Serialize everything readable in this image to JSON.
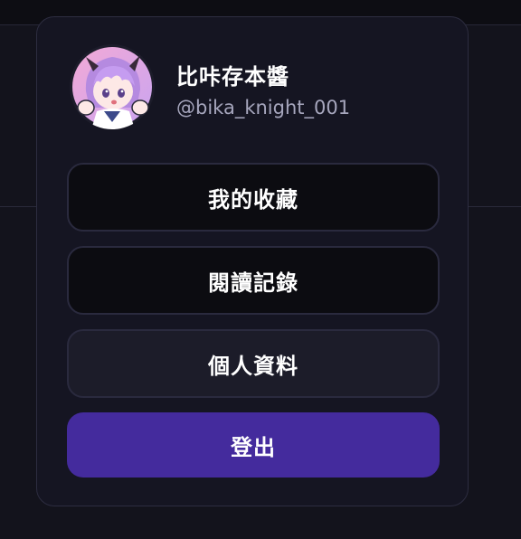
{
  "user": {
    "display_name": "比咔存本醬",
    "handle": "@bika_knight_001",
    "avatar_icon": "anime-avatar"
  },
  "menu": {
    "favorites_label": "我的收藏",
    "history_label": "閱讀記錄",
    "profile_label": "個人資料",
    "logout_label": "登出"
  },
  "colors": {
    "card_background": "#151522",
    "logout_accent": "#442b9d",
    "handle_text": "#a6a6bd"
  }
}
